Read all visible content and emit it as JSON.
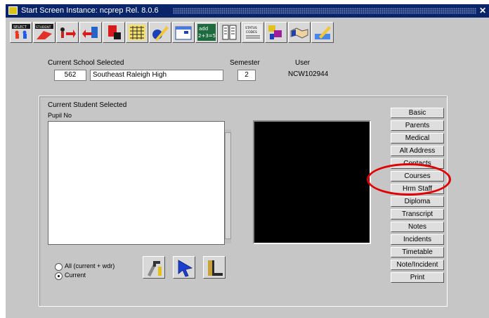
{
  "window": {
    "title": "Start Screen   Instance: ncprep   Rel. 8.0.6",
    "close_glyph": "✕"
  },
  "toolbar": {
    "buttons": [
      {
        "name": "select-student-icon"
      },
      {
        "name": "student-icon"
      },
      {
        "name": "transfer-in-icon"
      },
      {
        "name": "transfer-out-icon"
      },
      {
        "name": "calendar-icon"
      },
      {
        "name": "scheduling-icon"
      },
      {
        "name": "edit-pencil-icon"
      },
      {
        "name": "report-icon"
      },
      {
        "name": "grades-math-icon"
      },
      {
        "name": "documents-icon"
      },
      {
        "name": "status-codes-icon"
      },
      {
        "name": "logic-icon"
      },
      {
        "name": "handshake-icon"
      },
      {
        "name": "writing-icon"
      }
    ],
    "labels": {
      "select": "SELECT",
      "student": "STUDENT",
      "add": "add",
      "math": "2+3=5",
      "status": "STATUS",
      "codes": "CODES"
    }
  },
  "school": {
    "label": "Current School Selected",
    "code": "562",
    "name": "Southeast Raleigh High"
  },
  "semester": {
    "label": "Semester",
    "value": "2"
  },
  "user": {
    "label": "User",
    "value": "NCW102944"
  },
  "student": {
    "group_label": "Current Student Selected",
    "pupil_label": "Pupil No"
  },
  "radios": {
    "all": "All (current + wdr)",
    "current": "Current"
  },
  "sidebar": {
    "items": [
      "Basic",
      "Parents",
      "Medical",
      "Alt Address",
      "Contacts",
      "Courses",
      "Hrm Staff",
      "Diploma",
      "Transcript",
      "Notes",
      "Incidents",
      "Timetable",
      "Note/Incident",
      "Print"
    ]
  },
  "colors": {
    "titlebar": "#0a246a",
    "window": "#c6c6c6",
    "highlight_circle": "#e00000"
  }
}
